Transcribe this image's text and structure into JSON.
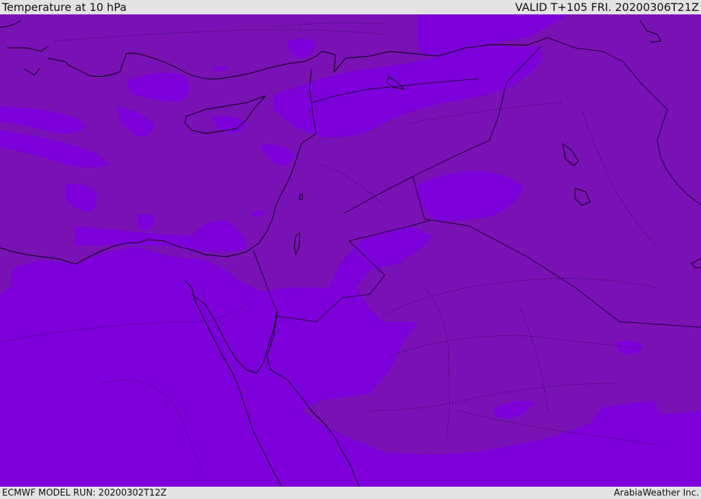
{
  "header": {
    "title": "Temperature at 10 hPa",
    "valid": "VALID T+105 FRI. 20200306T21Z"
  },
  "footer": {
    "model_run": "ECMWF MODEL RUN: 20200302T12Z",
    "credit": "ArabiaWeather Inc."
  },
  "colors": {
    "band_warm": "#7812b5",
    "band_cool": "#7d00da",
    "coastline": "#000000",
    "border": "#1a0033",
    "bar_bg": "#e3e3e3"
  }
}
